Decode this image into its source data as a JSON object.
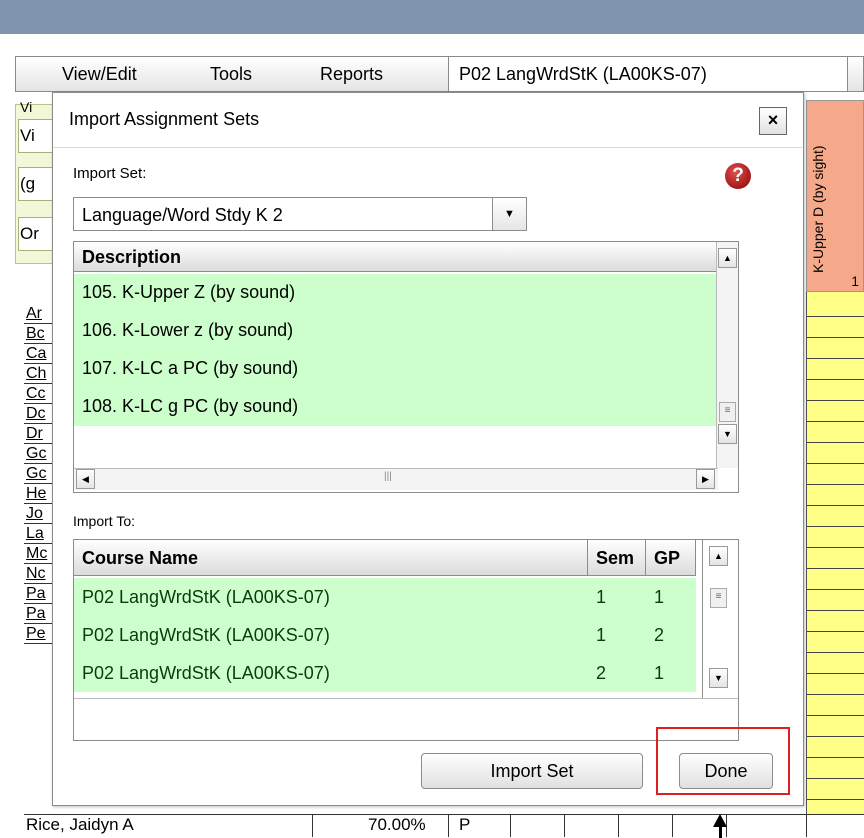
{
  "menubar": {
    "items": [
      "View/Edit",
      "Tools",
      "Reports"
    ],
    "course_selector": "P02   LangWrdStK (LA00KS-07)"
  },
  "options_panel": {
    "label": "Vi",
    "field1": "Vi",
    "field2": "(g",
    "field3": "Or"
  },
  "students": {
    "names": [
      "Ar",
      "Bc",
      "Ca",
      "Ch",
      "Cc",
      "Dc",
      "Dr",
      "Gc",
      "Gc",
      "He",
      "Jo",
      "La",
      "Mc",
      "Nc",
      "Pa",
      "Pa",
      "Pe"
    ],
    "last_row": {
      "name": "Rice, Jaidyn A",
      "percent": "70.00%",
      "code": "P"
    }
  },
  "right_column": {
    "header": "K-Upper D (by sight)",
    "number": "1"
  },
  "dialog": {
    "title": "Import Assignment Sets",
    "close_label": "×",
    "import_set_label": "Import Set:",
    "help_label": "?",
    "selected_set": "Language/Word Stdy K 2",
    "description_header": "Description",
    "descriptions": [
      "105. K-Upper Z (by sound)",
      "106. K-Lower z (by sound)",
      "107. K-LC a PC (by sound)",
      "108. K-LC g PC (by sound)"
    ],
    "import_to_label": "Import To:",
    "columns": [
      "Course Name",
      "Sem",
      "GP"
    ],
    "courses": [
      {
        "name": "P02   LangWrdStK (LA00KS-07)",
        "sem": "1",
        "gp": "1"
      },
      {
        "name": "P02   LangWrdStK (LA00KS-07)",
        "sem": "1",
        "gp": "2"
      },
      {
        "name": "P02   LangWrdStK (LA00KS-07)",
        "sem": "2",
        "gp": "1"
      }
    ],
    "import_button": "Import Set",
    "done_button": "Done"
  },
  "colors": {
    "row_highlight": "#ccffcc",
    "grid_yellow": "#ffff88",
    "header_salmon": "#f5a98a",
    "callout_red": "#e02020"
  }
}
